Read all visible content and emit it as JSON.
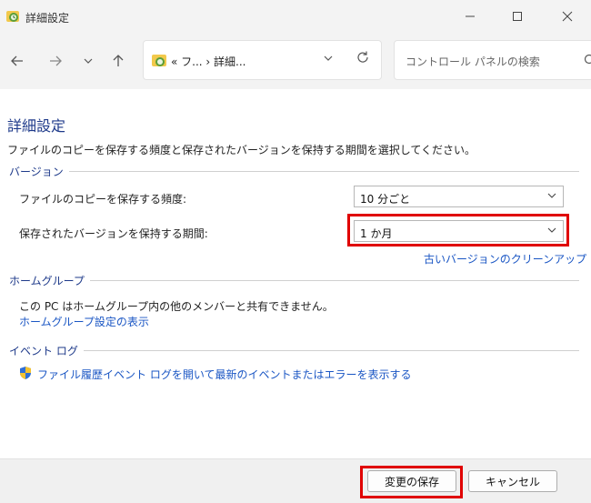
{
  "window": {
    "title": "詳細設定"
  },
  "nav": {
    "back_icon": "arrow-left-icon",
    "forward_icon": "arrow-right-icon",
    "recent_icon": "chevron-down-icon",
    "up_icon": "arrow-up-icon",
    "breadcrumb": "« フ... › 詳細...",
    "refresh_icon": "refresh-icon",
    "search_placeholder": "コントロール パネルの検索"
  },
  "main": {
    "title": "詳細設定",
    "intro": "ファイルのコピーを保存する頻度と保存されたバージョンを保持する期間を選択してください。",
    "versions": {
      "label": "バージョン",
      "frequency_label": "ファイルのコピーを保存する頻度:",
      "frequency_value": "10 分ごと",
      "retention_label": "保存されたバージョンを保持する期間:",
      "retention_value": "1 か月",
      "cleanup_link": "古いバージョンのクリーンアップ"
    },
    "homegroup": {
      "label": "ホームグループ",
      "text": "この PC はホームグループ内の他のメンバーと共有できません。",
      "link": "ホームグループ設定の表示"
    },
    "eventlog": {
      "label": "イベント ログ",
      "link": "ファイル履歴イベント ログを開いて最新のイベントまたはエラーを表示する"
    }
  },
  "footer": {
    "save_label": "変更の保存",
    "cancel_label": "キャンセル"
  },
  "colors": {
    "highlight": "#e00000",
    "link": "#1a56c4",
    "heading": "#1e3a8a"
  }
}
